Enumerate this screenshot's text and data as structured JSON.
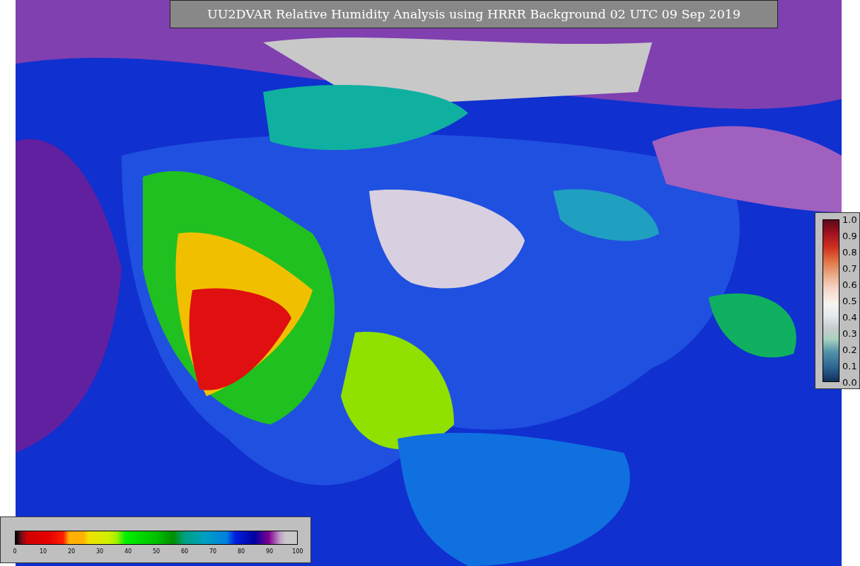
{
  "title": "UU2DVAR Relative Humidity Analysis using HRRR Background 02 UTC 09 Sep 2019",
  "colorbar_bottom": {
    "ticks": [
      "0",
      "10",
      "20",
      "30",
      "40",
      "50",
      "60",
      "70",
      "80",
      "90",
      "100"
    ]
  },
  "colorbar_right": {
    "ticks": [
      "1.0",
      "0.9",
      "0.8",
      "0.7",
      "0.6",
      "0.5",
      "0.4",
      "0.3",
      "0.2",
      "0.1",
      "0.0"
    ]
  }
}
